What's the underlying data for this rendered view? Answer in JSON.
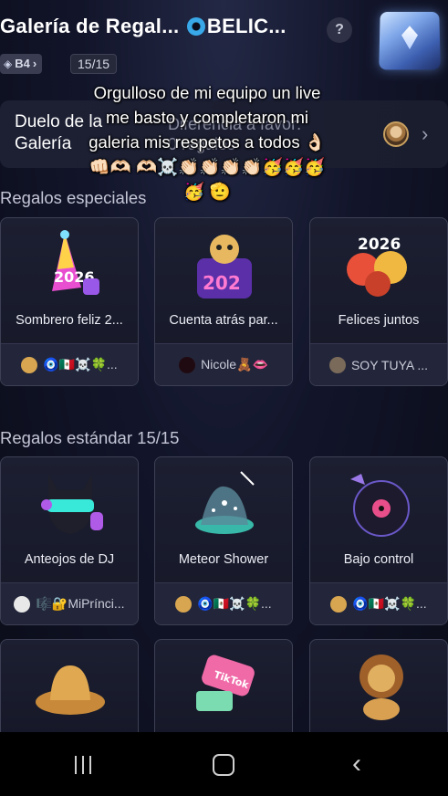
{
  "header": {
    "title_prefix": "Galería de Regal... ",
    "title_name": "BELIC...",
    "help_label": "?",
    "level_badge": "B4",
    "level_chevron": "›",
    "gallery_count": "15/15"
  },
  "duel": {
    "title": "Duelo de la Galería",
    "diff_label": "Diferencia a favor:",
    "diff_value": "0 regalos",
    "chevron": "›"
  },
  "caption": {
    "text": "Orgulloso de mi equipo un live me basto y completaron mi galeria mis respetos a todos 👌🏻👊🏻🫶🏻 🫶🏻☠️👏🏻👏🏻👏🏻👏🏻🥳🥳🥳🥳 🫡"
  },
  "sections": {
    "special_title": "Regalos especiales",
    "standard_title": "Regalos estándar 15/15"
  },
  "special_gifts": [
    {
      "name": "Sombrero feliz 2...",
      "owner": "🧿🇲🇽☠️🍀..."
    },
    {
      "name": "Cuenta atrás par...",
      "owner": "Nicole🧸👄"
    },
    {
      "name": "Felices juntos",
      "owner": "SOY TUYA ..."
    }
  ],
  "standard_gifts": [
    {
      "name": "Anteojos de DJ",
      "owner": "🎼🔐MiPrínci..."
    },
    {
      "name": "Meteor Shower",
      "owner": "🧿🇲🇽☠️🍀..."
    },
    {
      "name": "Bajo control",
      "owner": "🧿🇲🇽☠️🍀..."
    },
    {
      "name": "",
      "owner": ""
    },
    {
      "name": "",
      "owner": ""
    },
    {
      "name": "",
      "owner": ""
    }
  ],
  "colors": {
    "background": "#0b0d1c",
    "card": "#1c1f31",
    "card_border": "#3d4054",
    "accent_blue": "#38a8e8"
  },
  "icons": {
    "help": "question-icon",
    "gallery": "gallery-cube-icon",
    "level": "diamond-icon",
    "duel_more": "chevron-right-icon",
    "nav_recent": "recent-apps-icon",
    "nav_home": "home-icon",
    "nav_back": "back-icon"
  }
}
